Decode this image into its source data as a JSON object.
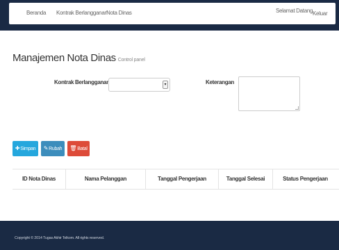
{
  "nav": {
    "links": [
      "Beranda",
      "Kontrak Berlangganan",
      "Nota Dinas"
    ],
    "welcome": "Selamat Datang",
    "logout": "Keluar"
  },
  "page": {
    "title": "Manajemen Nota Dinas",
    "subtitle": "Control panel"
  },
  "form": {
    "kontrak_label": "Kontrak Berlangganan",
    "kontrak_value": "",
    "keterangan_label": "Keterangan",
    "keterangan_value": ""
  },
  "buttons": {
    "simpan": "Simpan",
    "ubah": "Rubah",
    "batal": "Batal"
  },
  "table": {
    "columns": [
      "ID Nota Dinas",
      "Nama Pelanggan",
      "Tanggal Pengerjaan",
      "Tanggal Selesai",
      "Status Pengerjaan"
    ],
    "rows": []
  },
  "footer": {
    "copyright": "Copyright © 2014 Tugas Akhir Telkom. All rights reserved."
  },
  "colors": {
    "navbar": "#1a2a44",
    "simpan": "#25a7dd",
    "ubah": "#3c8dbc",
    "batal": "#dd4b39"
  },
  "icons": {
    "simpan": "plus-icon",
    "ubah": "pencil-icon",
    "batal": "trash-icon",
    "select": "chevron-down-icon"
  }
}
